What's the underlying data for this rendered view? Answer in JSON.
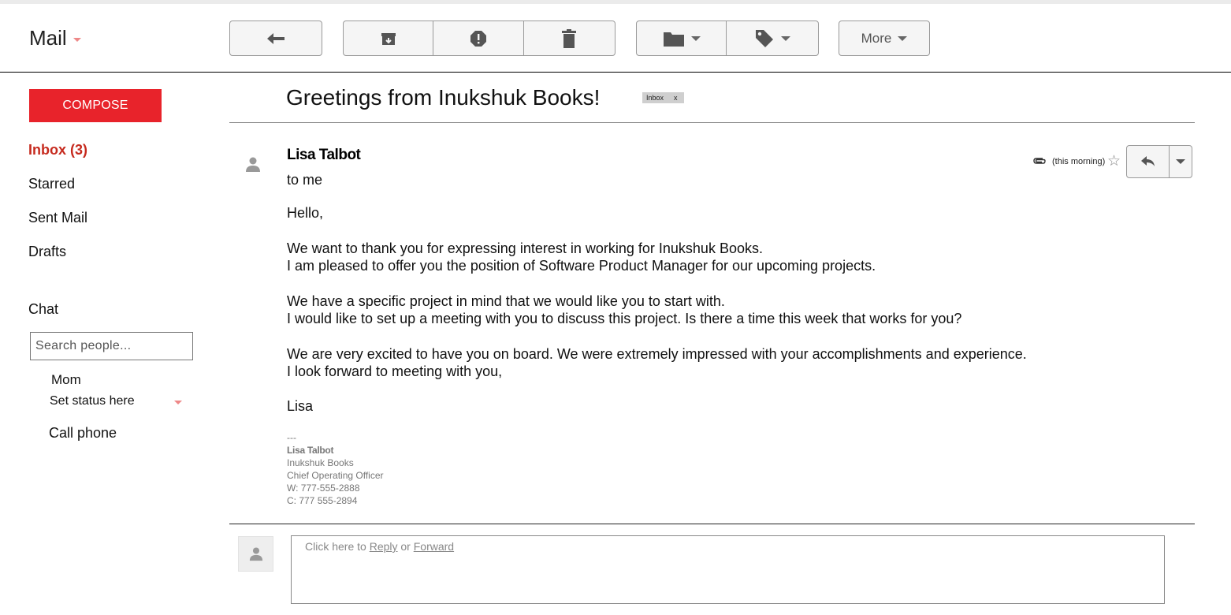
{
  "header": {
    "app_title": "Mail",
    "toolbar": {
      "reply": {
        "icon": "reply-icon"
      },
      "archive": {
        "icon": "archive-icon"
      },
      "spam": {
        "icon": "report-spam-icon"
      },
      "delete": {
        "icon": "trash-icon"
      },
      "move": {
        "icon": "folder-icon"
      },
      "labels": {
        "icon": "tag-icon"
      },
      "more_label": "More"
    }
  },
  "sidebar": {
    "compose_label": "COMPOSE",
    "nav": [
      {
        "label": "Inbox (3)",
        "active": true
      },
      {
        "label": "Starred"
      },
      {
        "label": "Sent Mail"
      },
      {
        "label": "Drafts"
      }
    ],
    "chat": {
      "title": "Chat",
      "search_placeholder": "Search people...",
      "contact_name": "Mom",
      "status_label": "Set status here",
      "call_phone_label": "Call phone"
    }
  },
  "message": {
    "subject": "Greetings from Inukshuk Books!",
    "label_chip": {
      "text": "Inbox",
      "remove": "x"
    },
    "sender": "Lisa Talbot",
    "recipient": "to me",
    "time": "(this morning)",
    "star": "☆",
    "body": [
      "Hello,",
      "We want to thank you for expressing interest in working for Inukshuk Books.",
      "I am pleased to offer you the position of Software Product Manager for our upcoming projects.",
      "We have a specific project in mind that we would like you to start with.",
      "I would like to set up a meeting with you to discuss this project. Is there a time this week that works for you?",
      "We are very excited to have you on board. We were extremely impressed with your accomplishments and experience.",
      "I look forward to meeting with you,",
      "Lisa"
    ],
    "signature": {
      "separator": "---",
      "name": "Lisa Talbot",
      "company": "Inukshuk Books",
      "title": "Chief Operating Officer",
      "work_phone": "W: 777-555-2888",
      "cell_phone": "C: 777 555-2894"
    }
  },
  "reply_box": {
    "prefix": "Click here to ",
    "reply_link": "Reply",
    "middle": " or ",
    "forward_link": "Forward"
  },
  "colors": {
    "accent": "#e8232b",
    "active_nav": "#c62a1e",
    "status_caret": "#ee8888"
  }
}
